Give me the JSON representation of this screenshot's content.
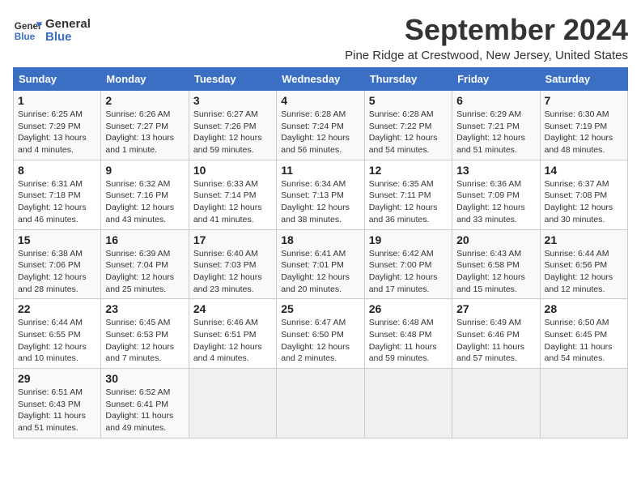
{
  "header": {
    "logo_line1": "General",
    "logo_line2": "Blue",
    "title": "September 2024",
    "subtitle": "Pine Ridge at Crestwood, New Jersey, United States"
  },
  "weekdays": [
    "Sunday",
    "Monday",
    "Tuesday",
    "Wednesday",
    "Thursday",
    "Friday",
    "Saturday"
  ],
  "weeks": [
    [
      {
        "day": "1",
        "info": "Sunrise: 6:25 AM\nSunset: 7:29 PM\nDaylight: 13 hours\nand 4 minutes."
      },
      {
        "day": "2",
        "info": "Sunrise: 6:26 AM\nSunset: 7:27 PM\nDaylight: 13 hours\nand 1 minute."
      },
      {
        "day": "3",
        "info": "Sunrise: 6:27 AM\nSunset: 7:26 PM\nDaylight: 12 hours\nand 59 minutes."
      },
      {
        "day": "4",
        "info": "Sunrise: 6:28 AM\nSunset: 7:24 PM\nDaylight: 12 hours\nand 56 minutes."
      },
      {
        "day": "5",
        "info": "Sunrise: 6:28 AM\nSunset: 7:22 PM\nDaylight: 12 hours\nand 54 minutes."
      },
      {
        "day": "6",
        "info": "Sunrise: 6:29 AM\nSunset: 7:21 PM\nDaylight: 12 hours\nand 51 minutes."
      },
      {
        "day": "7",
        "info": "Sunrise: 6:30 AM\nSunset: 7:19 PM\nDaylight: 12 hours\nand 48 minutes."
      }
    ],
    [
      {
        "day": "8",
        "info": "Sunrise: 6:31 AM\nSunset: 7:18 PM\nDaylight: 12 hours\nand 46 minutes."
      },
      {
        "day": "9",
        "info": "Sunrise: 6:32 AM\nSunset: 7:16 PM\nDaylight: 12 hours\nand 43 minutes."
      },
      {
        "day": "10",
        "info": "Sunrise: 6:33 AM\nSunset: 7:14 PM\nDaylight: 12 hours\nand 41 minutes."
      },
      {
        "day": "11",
        "info": "Sunrise: 6:34 AM\nSunset: 7:13 PM\nDaylight: 12 hours\nand 38 minutes."
      },
      {
        "day": "12",
        "info": "Sunrise: 6:35 AM\nSunset: 7:11 PM\nDaylight: 12 hours\nand 36 minutes."
      },
      {
        "day": "13",
        "info": "Sunrise: 6:36 AM\nSunset: 7:09 PM\nDaylight: 12 hours\nand 33 minutes."
      },
      {
        "day": "14",
        "info": "Sunrise: 6:37 AM\nSunset: 7:08 PM\nDaylight: 12 hours\nand 30 minutes."
      }
    ],
    [
      {
        "day": "15",
        "info": "Sunrise: 6:38 AM\nSunset: 7:06 PM\nDaylight: 12 hours\nand 28 minutes."
      },
      {
        "day": "16",
        "info": "Sunrise: 6:39 AM\nSunset: 7:04 PM\nDaylight: 12 hours\nand 25 minutes."
      },
      {
        "day": "17",
        "info": "Sunrise: 6:40 AM\nSunset: 7:03 PM\nDaylight: 12 hours\nand 23 minutes."
      },
      {
        "day": "18",
        "info": "Sunrise: 6:41 AM\nSunset: 7:01 PM\nDaylight: 12 hours\nand 20 minutes."
      },
      {
        "day": "19",
        "info": "Sunrise: 6:42 AM\nSunset: 7:00 PM\nDaylight: 12 hours\nand 17 minutes."
      },
      {
        "day": "20",
        "info": "Sunrise: 6:43 AM\nSunset: 6:58 PM\nDaylight: 12 hours\nand 15 minutes."
      },
      {
        "day": "21",
        "info": "Sunrise: 6:44 AM\nSunset: 6:56 PM\nDaylight: 12 hours\nand 12 minutes."
      }
    ],
    [
      {
        "day": "22",
        "info": "Sunrise: 6:44 AM\nSunset: 6:55 PM\nDaylight: 12 hours\nand 10 minutes."
      },
      {
        "day": "23",
        "info": "Sunrise: 6:45 AM\nSunset: 6:53 PM\nDaylight: 12 hours\nand 7 minutes."
      },
      {
        "day": "24",
        "info": "Sunrise: 6:46 AM\nSunset: 6:51 PM\nDaylight: 12 hours\nand 4 minutes."
      },
      {
        "day": "25",
        "info": "Sunrise: 6:47 AM\nSunset: 6:50 PM\nDaylight: 12 hours\nand 2 minutes."
      },
      {
        "day": "26",
        "info": "Sunrise: 6:48 AM\nSunset: 6:48 PM\nDaylight: 11 hours\nand 59 minutes."
      },
      {
        "day": "27",
        "info": "Sunrise: 6:49 AM\nSunset: 6:46 PM\nDaylight: 11 hours\nand 57 minutes."
      },
      {
        "day": "28",
        "info": "Sunrise: 6:50 AM\nSunset: 6:45 PM\nDaylight: 11 hours\nand 54 minutes."
      }
    ],
    [
      {
        "day": "29",
        "info": "Sunrise: 6:51 AM\nSunset: 6:43 PM\nDaylight: 11 hours\nand 51 minutes."
      },
      {
        "day": "30",
        "info": "Sunrise: 6:52 AM\nSunset: 6:41 PM\nDaylight: 11 hours\nand 49 minutes."
      },
      {
        "day": "",
        "info": ""
      },
      {
        "day": "",
        "info": ""
      },
      {
        "day": "",
        "info": ""
      },
      {
        "day": "",
        "info": ""
      },
      {
        "day": "",
        "info": ""
      }
    ]
  ]
}
